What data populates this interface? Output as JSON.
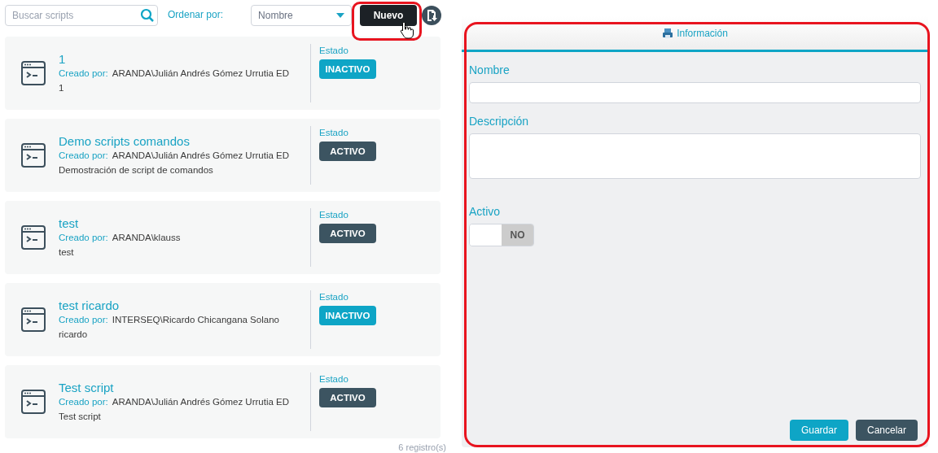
{
  "toolbar": {
    "search": {
      "placeholder": "Buscar scripts"
    },
    "sort_label": "Ordenar por:",
    "sort_select": {
      "value": "Nombre"
    },
    "new_button": "Nuevo"
  },
  "scripts": [
    {
      "name": "1",
      "created_by_label": "Creado por:",
      "created_by": "ARANDA\\Julián Andrés Gómez Urrutia ED",
      "description": "1",
      "status_label": "Estado",
      "status": "INACTIVO",
      "active": false
    },
    {
      "name": "Demo scripts comandos",
      "created_by_label": "Creado por:",
      "created_by": "ARANDA\\Julián Andrés Gómez Urrutia ED",
      "description": "Demostración de script de comandos",
      "status_label": "Estado",
      "status": "ACTIVO",
      "active": true
    },
    {
      "name": "test",
      "created_by_label": "Creado por:",
      "created_by": "ARANDA\\klauss",
      "description": "test",
      "status_label": "Estado",
      "status": "ACTIVO",
      "active": true
    },
    {
      "name": "test ricardo",
      "created_by_label": "Creado por:",
      "created_by": "INTERSEQ\\Ricardo Chicangana Solano",
      "description": "ricardo",
      "status_label": "Estado",
      "status": "INACTIVO",
      "active": false
    },
    {
      "name": "Test script",
      "created_by_label": "Creado por:",
      "created_by": "ARANDA\\Julián Andrés Gómez Urrutia ED",
      "description": "Test script",
      "status_label": "Estado",
      "status": "ACTIVO",
      "active": true
    }
  ],
  "record_count": "6 registro(s)",
  "form": {
    "tab": "Información",
    "name_label": "Nombre",
    "description_label": "Descripción",
    "active_label": "Activo",
    "active_toggle": {
      "on": false,
      "label": "NO"
    },
    "buttons": [
      {
        "label": "Guardar",
        "kind": "primary"
      },
      {
        "label": "Cancelar",
        "kind": "secondary"
      }
    ]
  }
}
